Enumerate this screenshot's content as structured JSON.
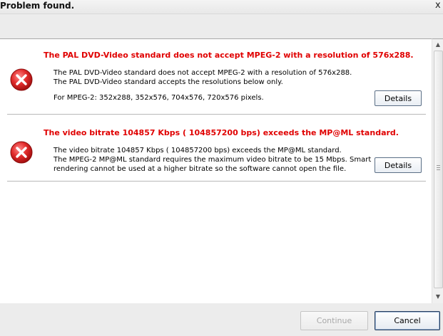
{
  "window": {
    "title": "Problem found.",
    "close_glyph": "x"
  },
  "issues": [
    {
      "icon": "error-icon",
      "heading": "The PAL DVD-Video standard does not accept MPEG-2 with a resolution of 576x288.",
      "lines": [
        "The PAL DVD-Video standard does not accept MPEG-2 with a resolution of 576x288.",
        "The PAL DVD-Video standard accepts the resolutions below only.",
        "",
        "For MPEG-2: 352x288, 352x576, 704x576, 720x576 pixels."
      ],
      "details_label": "Details"
    },
    {
      "icon": "error-icon",
      "heading": "The video bitrate 104857 Kbps ( 104857200 bps) exceeds the MP@ML standard.",
      "lines": [
        "The video bitrate 104857 Kbps ( 104857200 bps) exceeds the MP@ML standard.",
        "The MPEG-2 MP@ML standard requires the maximum video bitrate to be 15 Mbps. Smart",
        "rendering cannot be used at a higher bitrate so the software cannot open the file."
      ],
      "details_label": "Details"
    }
  ],
  "footer": {
    "continue_label": "Continue",
    "continue_enabled": false,
    "cancel_label": "Cancel"
  },
  "colors": {
    "heading_red": "#e00000",
    "icon_red": "#d42020"
  }
}
